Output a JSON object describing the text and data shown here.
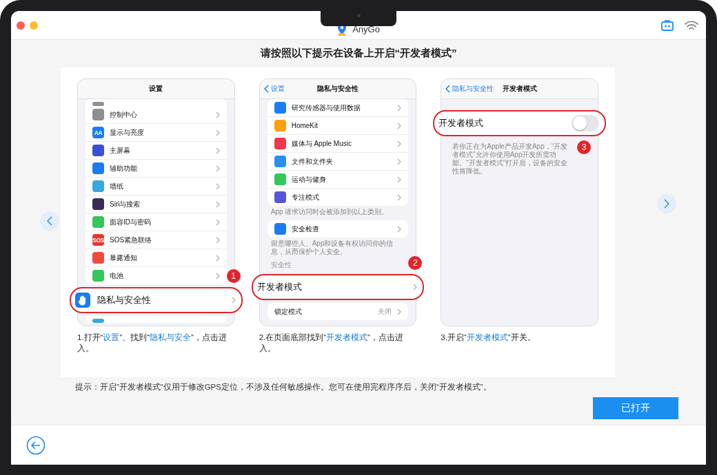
{
  "window": {
    "title": "AnyGo"
  },
  "heading": "请按照以下提示在设备上开启“开发者模式”",
  "steps": [
    {
      "nav": {
        "title": "设置"
      },
      "caption": "1.打开“**设置**”、找到“**隐私与安全**”，点击进入。",
      "items": [
        {
          "kind": "group",
          "rows": [
            {
              "kind": "cut",
              "color": "#8e8e93"
            },
            {
              "kind": "row",
              "label": "控制中心",
              "color": "#8e8e93"
            },
            {
              "kind": "row",
              "label": "显示与亮度",
              "color": "#1a7cf5",
              "icon_text": "AA"
            },
            {
              "kind": "row",
              "label": "主屏幕",
              "color": "#3a4fd8"
            },
            {
              "kind": "row",
              "label": "辅助功能",
              "color": "#1a7cf5"
            },
            {
              "kind": "row",
              "label": "墙纸",
              "color": "#38a8e0"
            },
            {
              "kind": "row",
              "label": "Siri与搜索",
              "color": "#3a2a5a"
            },
            {
              "kind": "row",
              "label": "面容ID与密码",
              "color": "#34c759"
            },
            {
              "kind": "row",
              "label": "SOS紧急联络",
              "color": "#e8352a",
              "icon_text": "SOS"
            },
            {
              "kind": "row",
              "label": "暴露通知",
              "color": "#ef4a3c"
            },
            {
              "kind": "row",
              "label": "电池",
              "color": "#34c759"
            }
          ]
        },
        {
          "kind": "highlight",
          "label": "隐私与安全性",
          "color": "#1a7cf5",
          "badge": "1"
        },
        {
          "kind": "group",
          "rows": [
            {
              "kind": "cut",
              "color": "#38a8e0"
            }
          ]
        }
      ]
    },
    {
      "nav": {
        "back": "设置",
        "title": "隐私与安全性"
      },
      "caption": "2.在页面底部找到“**开发者模式**”，点击进入。",
      "items": [
        {
          "kind": "group",
          "rows": [
            {
              "kind": "row",
              "label": "研究传感器与使用数据",
              "color": "#1a7cf5"
            },
            {
              "kind": "row",
              "label": "HomeKit",
              "color": "#ff9f0a"
            },
            {
              "kind": "row",
              "label": "媒体与 Apple Music",
              "color": "#f0364d"
            },
            {
              "kind": "row",
              "label": "文件和文件夹",
              "color": "#2a8ff0"
            },
            {
              "kind": "row",
              "label": "运动与健身",
              "color": "#34c759"
            },
            {
              "kind": "row",
              "label": "专注模式",
              "color": "#5856d6"
            }
          ]
        },
        {
          "kind": "note",
          "text": "App 请求访问时会被添加到以上类别。"
        },
        {
          "kind": "group",
          "rows": [
            {
              "kind": "row",
              "label": "安全检查",
              "color": "#1a7cf5"
            }
          ]
        },
        {
          "kind": "note",
          "text": "留意哪些人、App和设备有权访问你的信息，从而保护个人安全。"
        },
        {
          "kind": "section",
          "text": "安全性"
        },
        {
          "kind": "highlight",
          "label": "开发者模式",
          "badge": "2"
        },
        {
          "kind": "group",
          "rows": [
            {
              "kind": "row",
              "label": "锁定模式",
              "value": "关闭"
            }
          ]
        }
      ]
    },
    {
      "nav": {
        "back": "隐私与安全性",
        "title": "开发者模式"
      },
      "caption": "3.开启“**开发者模式**”开关。",
      "items": [
        {
          "kind": "highlight_toggle",
          "label": "开发者模式",
          "on": false,
          "badge": "3"
        },
        {
          "kind": "note",
          "text": "若你正在为Apple产品开发App，“开发者模式”允许你使用App开发所需功能。“开发者模式”打开后，设备的安全性将降低。"
        }
      ]
    }
  ],
  "hint": "提示：开启”开发者模式“仅用于修改GPS定位，不涉及任何敏感操作。您可在使用完程序序后，关闭“开发者模式”。",
  "confirm_button": "已打开"
}
